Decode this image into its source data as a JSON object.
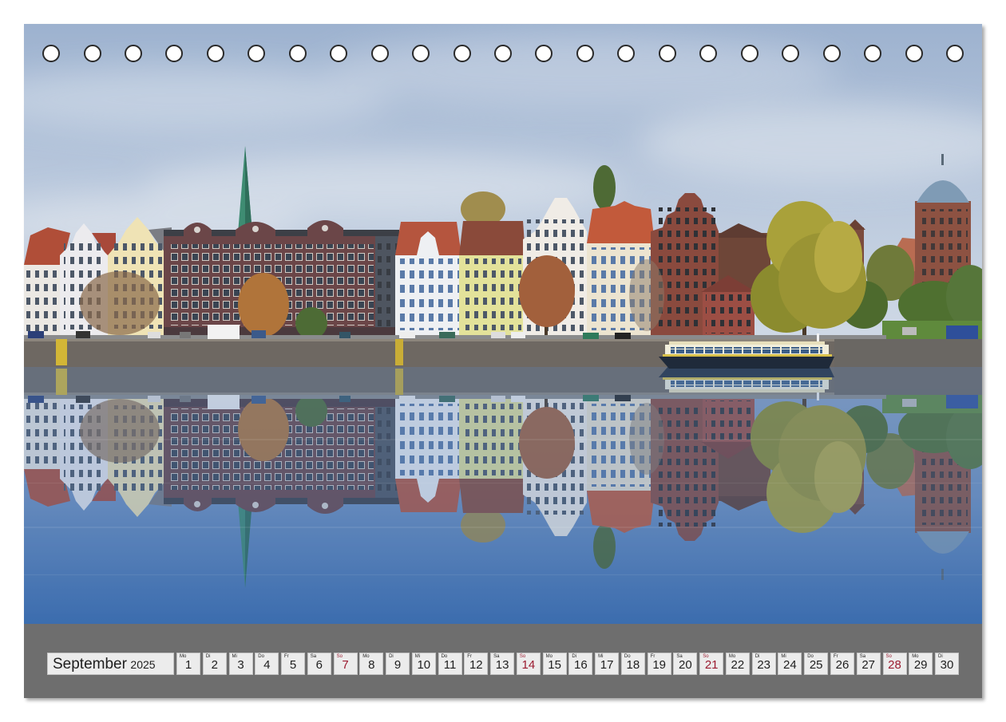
{
  "calendar": {
    "month": "September",
    "year": "2025",
    "days": [
      {
        "weekday": "Mo",
        "day": "1"
      },
      {
        "weekday": "Di",
        "day": "2"
      },
      {
        "weekday": "Mi",
        "day": "3"
      },
      {
        "weekday": "Do",
        "day": "4"
      },
      {
        "weekday": "Fr",
        "day": "5"
      },
      {
        "weekday": "Sa",
        "day": "6"
      },
      {
        "weekday": "So",
        "day": "7",
        "highlight": true
      },
      {
        "weekday": "Mo",
        "day": "8"
      },
      {
        "weekday": "Di",
        "day": "9"
      },
      {
        "weekday": "Mi",
        "day": "10"
      },
      {
        "weekday": "Do",
        "day": "11"
      },
      {
        "weekday": "Fr",
        "day": "12"
      },
      {
        "weekday": "Sa",
        "day": "13"
      },
      {
        "weekday": "So",
        "day": "14",
        "highlight": true
      },
      {
        "weekday": "Mo",
        "day": "15"
      },
      {
        "weekday": "Di",
        "day": "16"
      },
      {
        "weekday": "Mi",
        "day": "17"
      },
      {
        "weekday": "Do",
        "day": "18"
      },
      {
        "weekday": "Fr",
        "day": "19"
      },
      {
        "weekday": "Sa",
        "day": "20"
      },
      {
        "weekday": "So",
        "day": "21",
        "highlight": true
      },
      {
        "weekday": "Mo",
        "day": "22"
      },
      {
        "weekday": "Di",
        "day": "23"
      },
      {
        "weekday": "Mi",
        "day": "24"
      },
      {
        "weekday": "Do",
        "day": "25"
      },
      {
        "weekday": "Fr",
        "day": "26"
      },
      {
        "weekday": "Sa",
        "day": "27"
      },
      {
        "weekday": "So",
        "day": "28",
        "highlight": true
      },
      {
        "weekday": "Mo",
        "day": "29"
      },
      {
        "weekday": "Di",
        "day": "30"
      }
    ]
  },
  "colors": {
    "sunday": "#9b1b30",
    "bar": "#6e6e6e",
    "cell": "#ececec"
  }
}
